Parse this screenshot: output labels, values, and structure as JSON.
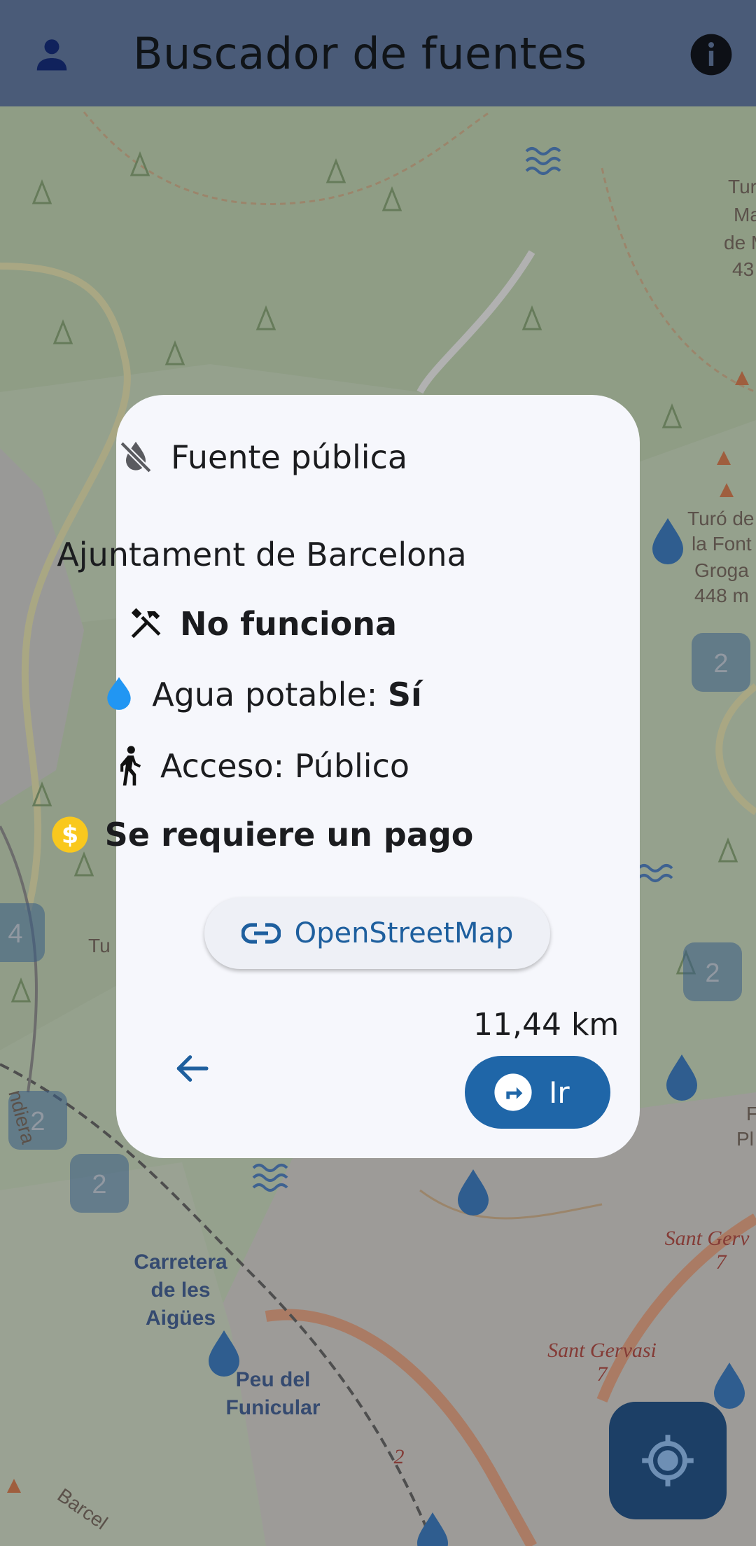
{
  "appbar": {
    "title": "Buscador de fuentes",
    "icons": [
      "person-icon",
      "info-icon"
    ]
  },
  "map": {
    "labels": {
      "carretera": [
        "Carretera",
        "de les",
        "Aigües"
      ],
      "peu": [
        "Peu del",
        "Funicular"
      ],
      "sant1": "Sant Gervasi",
      "sant1_num": "7",
      "sant2": "Sant Gerv",
      "sant2_num": "7",
      "turo": [
        "Turó de",
        "la Font",
        "Groga",
        "448 m"
      ],
      "turo_top": [
        "Tur",
        "Ma",
        "de M",
        "43"
      ],
      "tu_left": "Tu",
      "edge_right": [
        "F",
        "Pl"
      ],
      "edge_left": "ndiera",
      "barce": "Barcel",
      "road_num": "2"
    },
    "clusters": [
      "2",
      "2",
      "4",
      "2",
      "2"
    ]
  },
  "dialog": {
    "type_label": "Fuente pública",
    "operator": "Ajuntament de Barcelona",
    "status": "No funciona",
    "drinking_label": "Agua potable: ",
    "drinking_value": "Sí",
    "access": "Acceso: Público",
    "fee": "Se requiere un pago",
    "osm_label": "OpenStreetMap",
    "distance": "11,44 km",
    "go_label": "Ir"
  },
  "colors": {
    "appbar": "#4a5b78",
    "accent": "#1f66a8",
    "drop": "#2196f3",
    "coin": "#f9c81e"
  }
}
